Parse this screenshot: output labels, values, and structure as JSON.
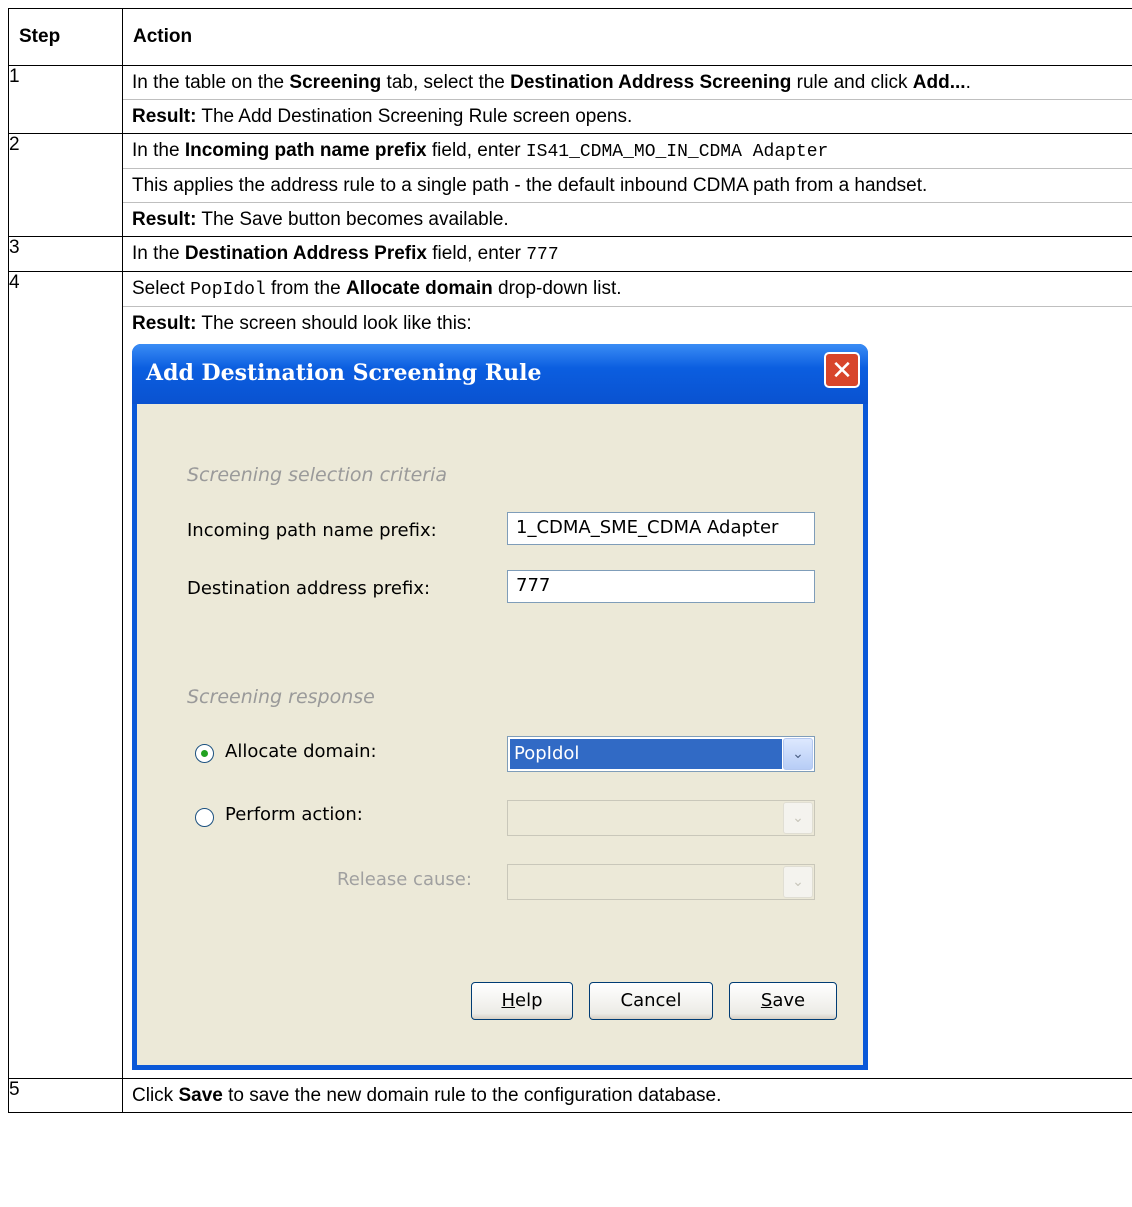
{
  "table": {
    "header": {
      "step": "Step",
      "action": "Action"
    },
    "rows": {
      "r1": {
        "step": "1",
        "p1": {
          "t1": "In the table on the ",
          "b1": "Screening",
          "t2": " tab, select the ",
          "b2": "Destination Address Screening",
          "t3": " rule and click ",
          "b3": "Add...",
          "t4": "."
        },
        "p2": {
          "b1": "Result:",
          "t1": " The Add Destination Screening Rule screen opens."
        }
      },
      "r2": {
        "step": "2",
        "p1": {
          "t1": "In the ",
          "b1": "Incoming path name prefix",
          "t2": " field, enter ",
          "code": "IS41_CDMA_MO_IN_CDMA Adapter"
        },
        "p2": {
          "t1": "This applies the address rule to a single path - the default inbound CDMA path from a handset."
        },
        "p3": {
          "b1": "Result:",
          "t1": " The Save button becomes available."
        }
      },
      "r3": {
        "step": "3",
        "p1": {
          "t1": "In the ",
          "b1": "Destination Address Prefix",
          "t2": " field, enter ",
          "code": "777"
        }
      },
      "r4": {
        "step": "4",
        "p1": {
          "t1": "Select ",
          "code": "PopIdol",
          "t2": " from the ",
          "b1": "Allocate domain",
          "t3": " drop-down list."
        },
        "p2": {
          "b1": "Result:",
          "t1": " The screen should look like this:"
        }
      },
      "r5": {
        "step": "5",
        "p1": {
          "t1": "Click ",
          "b1": "Save",
          "t2": " to save the new domain rule to the configuration database."
        }
      }
    }
  },
  "dialog": {
    "title": "Add Destination Screening Rule",
    "close_glyph": "✕",
    "criteria_header": "Screening selection criteria",
    "incoming_label": "Incoming path name prefix:",
    "incoming_value": "1_CDMA_SME_CDMA Adapter",
    "dest_label": "Destination address prefix:",
    "dest_value": "777",
    "response_header": "Screening response",
    "allocate_label": "Allocate domain:",
    "allocate_value": "PopIdol",
    "perform_label": "Perform action:",
    "perform_value": "",
    "release_label": "Release cause:",
    "release_value": "",
    "arrow_glyph": "⌄",
    "help_first": "H",
    "help_rest": "elp",
    "cancel_label": "Cancel",
    "save_first": "S",
    "save_rest": "ave"
  }
}
